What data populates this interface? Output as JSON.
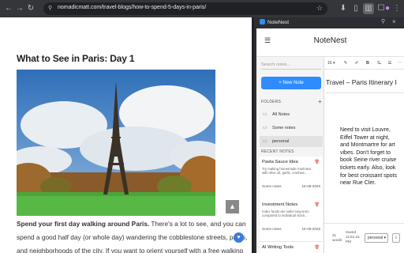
{
  "browser": {
    "url": "nomadicmatt.com/travel-blogs/how-to-spend-5-days-in-paris/"
  },
  "article": {
    "heading": "What to See in Paris: Day 1",
    "para_line1_bold": "Spend your first day walking around Paris.",
    "para_line1_rest": " There's a lot to see, and you can",
    "para_line2": "spend a good half day (or whole day) wandering the cobblestone streets, parks,",
    "para_line3": "and neighborhoods of the city. If you want to orient yourself with a free walking"
  },
  "panel": {
    "chrome_title": "NoteNest",
    "app_title": "NoteNest",
    "search_placeholder": "Search notes...",
    "new_note_label": "+ New Note",
    "folders_label": "FOLDERS",
    "folders": [
      {
        "name": "All Notes"
      },
      {
        "name": "Some notes"
      },
      {
        "name": "personal"
      }
    ],
    "recent_label": "RECENT NOTES",
    "notes": [
      {
        "title": "Pasta Sauce Idea",
        "desc": "Try making homemade marinara with olive oil, garlic, crushed...",
        "folder": "Some notes",
        "date": "16-08-2025"
      },
      {
        "title": "Investment Notes",
        "desc": "Index funds are safer long-term compared to individual stock...",
        "folder": "Some notes",
        "date": "16-08-2025"
      },
      {
        "title": "AI Writing Tools",
        "desc": "",
        "folder": "",
        "date": ""
      }
    ],
    "editor": {
      "font_size": "16",
      "title": "Travel – Paris Itinerary I",
      "body": "Need to visit Louvre, Eiffel Tower at night, and Montmartre for art vibes. Don't forget to book Seine river cruise tickets early. Also, look for best croissant spots near Rue Cler.",
      "word_count": "31\nwords",
      "saved": "Saved\n11:51:16\nPM",
      "folder_value": "personal"
    }
  },
  "colors": {
    "accent": "#2f8cff",
    "delete": "#e53935"
  }
}
